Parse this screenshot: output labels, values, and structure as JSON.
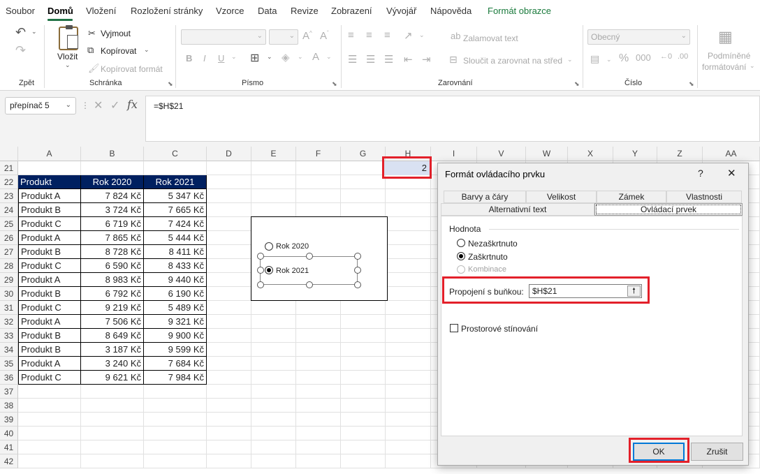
{
  "menu": {
    "items": [
      "Soubor",
      "Domů",
      "Vložení",
      "Rozložení stránky",
      "Vzorce",
      "Data",
      "Revize",
      "Zobrazení",
      "Vývojář",
      "Nápověda",
      "Formát obrazce"
    ]
  },
  "ribbon": {
    "undo_group": "Zpět",
    "clipboard": {
      "paste": "Vložit",
      "cut": "Vyjmout",
      "copy": "Kopírovat",
      "format_painter": "Kopírovat formát",
      "label": "Schránka"
    },
    "font": {
      "label": "Písmo"
    },
    "alignment": {
      "wrap": "Zalamovat text",
      "merge": "Sloučit a zarovnat na střed",
      "label": "Zarovnání"
    },
    "number": {
      "format": "Obecný",
      "label": "Číslo"
    },
    "styles": {
      "cond_1": "Podmíněné",
      "cond_2": "formátování"
    }
  },
  "formula_bar": {
    "name_box": "přepínač 5",
    "formula": "=$H$21"
  },
  "columns": [
    "A",
    "B",
    "C",
    "D",
    "E",
    "F",
    "G",
    "H",
    "I",
    "V",
    "W",
    "X",
    "Y",
    "Z",
    "AA"
  ],
  "rows": [
    "21",
    "22",
    "23",
    "24",
    "25",
    "26",
    "27",
    "28",
    "29",
    "30",
    "31",
    "32",
    "33",
    "34",
    "35",
    "36",
    "37",
    "38",
    "39",
    "40",
    "41",
    "42"
  ],
  "table": {
    "headers": [
      "Produkt",
      "Rok 2020",
      "Rok 2021"
    ],
    "rows": [
      [
        "Produkt A",
        "7 824 Kč",
        "5 347 Kč"
      ],
      [
        "Produkt B",
        "3 724 Kč",
        "7 665 Kč"
      ],
      [
        "Produkt C",
        "6 719 Kč",
        "7 424 Kč"
      ],
      [
        "Produkt A",
        "7 865 Kč",
        "5 444 Kč"
      ],
      [
        "Produkt B",
        "8 728 Kč",
        "8 411 Kč"
      ],
      [
        "Produkt C",
        "6 590 Kč",
        "8 433 Kč"
      ],
      [
        "Produkt A",
        "8 983 Kč",
        "9 440 Kč"
      ],
      [
        "Produkt B",
        "6 792 Kč",
        "6 190 Kč"
      ],
      [
        "Produkt C",
        "9 219 Kč",
        "5 489 Kč"
      ],
      [
        "Produkt A",
        "7 506 Kč",
        "9 321 Kč"
      ],
      [
        "Produkt B",
        "8 649 Kč",
        "9 900 Kč"
      ],
      [
        "Produkt B",
        "3 187 Kč",
        "9 599 Kč"
      ],
      [
        "Produkt A",
        "3 240 Kč",
        "7 684 Kč"
      ],
      [
        "Produkt C",
        "9 621 Kč",
        "7 984 Kč"
      ]
    ]
  },
  "cell_h21": "2",
  "option_buttons": {
    "opt1": "Rok 2020",
    "opt2": "Rok 2021"
  },
  "dialog": {
    "title": "Formát ovládacího prvku",
    "help": "?",
    "close": "✕",
    "tabs_row1": [
      "Barvy a čáry",
      "Velikost",
      "Zámek",
      "Vlastnosti"
    ],
    "tabs_row2": [
      "Alternativní text",
      "Ovládací prvek"
    ],
    "value_group": "Hodnota",
    "unchecked": "Nezaškrtnuto",
    "checked": "Zaškrtnuto",
    "mixed": "Kombinace",
    "link_label": "Propojení s buňkou:",
    "link_value": "$H$21",
    "shading": "Prostorové stínování",
    "ok": "OK",
    "cancel": "Zrušit"
  },
  "colors": {
    "accent": "#217346",
    "header_fill": "#002060",
    "highlight": "#e3202a",
    "selection": "#d9e1f2"
  }
}
